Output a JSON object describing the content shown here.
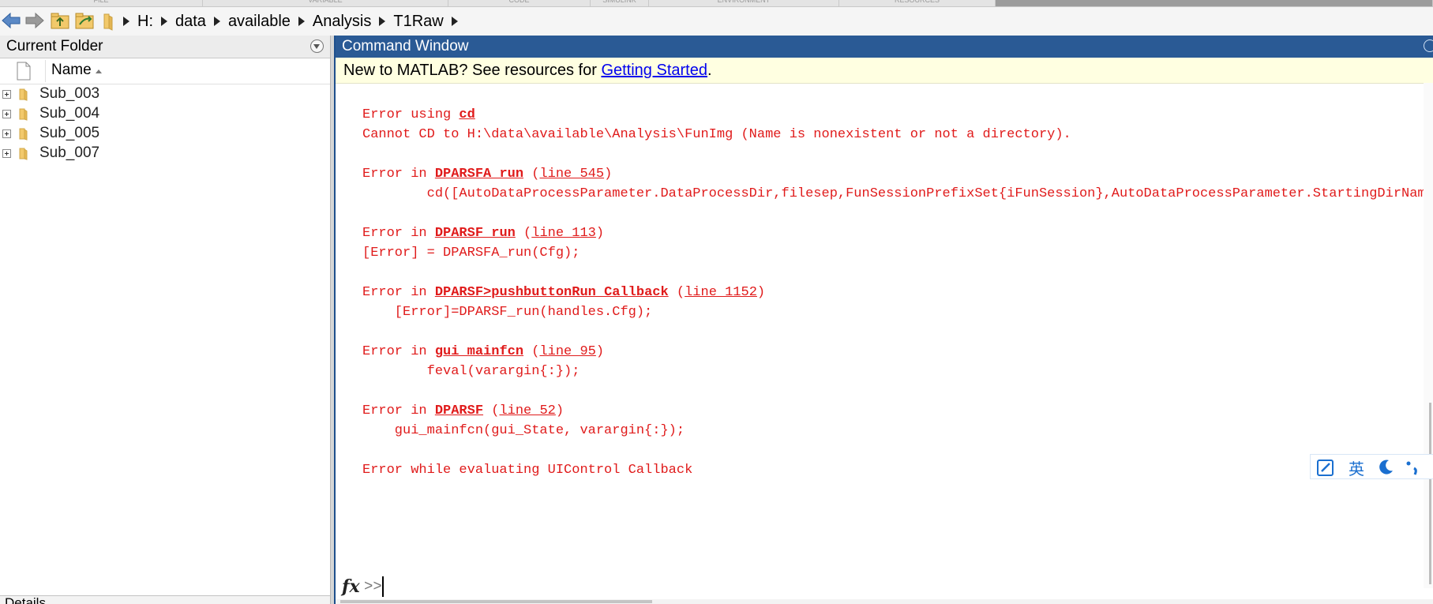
{
  "ribbon": {
    "tabs": [
      "FILE",
      "VARIABLE",
      "CODE",
      "SIMULINK",
      "ENVIRONMENT",
      "RESOURCES"
    ]
  },
  "address_bar": {
    "icons": [
      "back-arrow-icon",
      "forward-arrow-icon",
      "up-folder-icon",
      "browse-folder-icon",
      "folder-icon"
    ],
    "path": [
      "H:",
      "data",
      "available",
      "Analysis",
      "T1Raw"
    ]
  },
  "current_folder": {
    "title": "Current Folder",
    "column_name": "Name",
    "items": [
      {
        "name": "Sub_003"
      },
      {
        "name": "Sub_004"
      },
      {
        "name": "Sub_005"
      },
      {
        "name": "Sub_007"
      }
    ],
    "details_label": "Details"
  },
  "command_window": {
    "title": "Command Window",
    "info_prefix": "New to MATLAB? See resources for ",
    "info_link": "Getting Started",
    "info_suffix": ".",
    "output": {
      "e1_prefix": "Error using ",
      "e1_fn": "cd",
      "e1_msg": "Cannot CD to H:\\data\\available\\Analysis\\FunImg (Name is nonexistent or not a directory).",
      "e2_prefix": "Error in ",
      "e2_fn": "DPARSFA_run",
      "e2_open": " (",
      "e2_line": "line 545",
      "e2_close": ")",
      "e2_code": "        cd([AutoDataProcessParameter.DataProcessDir,filesep,FunSessionPrefixSet{iFunSession},AutoDataProcessParameter.StartingDirName])",
      "e3_prefix": "Error in ",
      "e3_fn": "DPARSF_run",
      "e3_open": " (",
      "e3_line": "line 113",
      "e3_close": ")",
      "e3_code": "[Error] = DPARSFA_run(Cfg);",
      "e4_prefix": "Error in ",
      "e4_fn": "DPARSF>pushbuttonRun_Callback",
      "e4_open": " (",
      "e4_line": "line 1152",
      "e4_close": ")",
      "e4_code": "    [Error]=DPARSF_run(handles.Cfg);",
      "e5_prefix": "Error in ",
      "e5_fn": "gui_mainfcn",
      "e5_open": " (",
      "e5_line": "line 95",
      "e5_close": ")",
      "e5_code": "        feval(varargin{:});",
      "e6_prefix": "Error in ",
      "e6_fn": "DPARSF",
      "e6_open": " (",
      "e6_line": "line 52",
      "e6_close": ")",
      "e6_code": "    gui_mainfcn(gui_State, varargin{:});",
      "e7_msg": "Error while evaluating UIControl Callback"
    },
    "prompt_icon": "fx",
    "prompt": ">>",
    "input_value": ""
  },
  "ime_toolbar": {
    "language": "英",
    "icons": [
      "pen-icon",
      "moon-icon",
      "punctuation-icon"
    ]
  },
  "colors": {
    "error_text": "#e01b1b",
    "title_bar": "#2a5a95",
    "info_bar": "#ffffe1",
    "link": "#0000ee"
  }
}
